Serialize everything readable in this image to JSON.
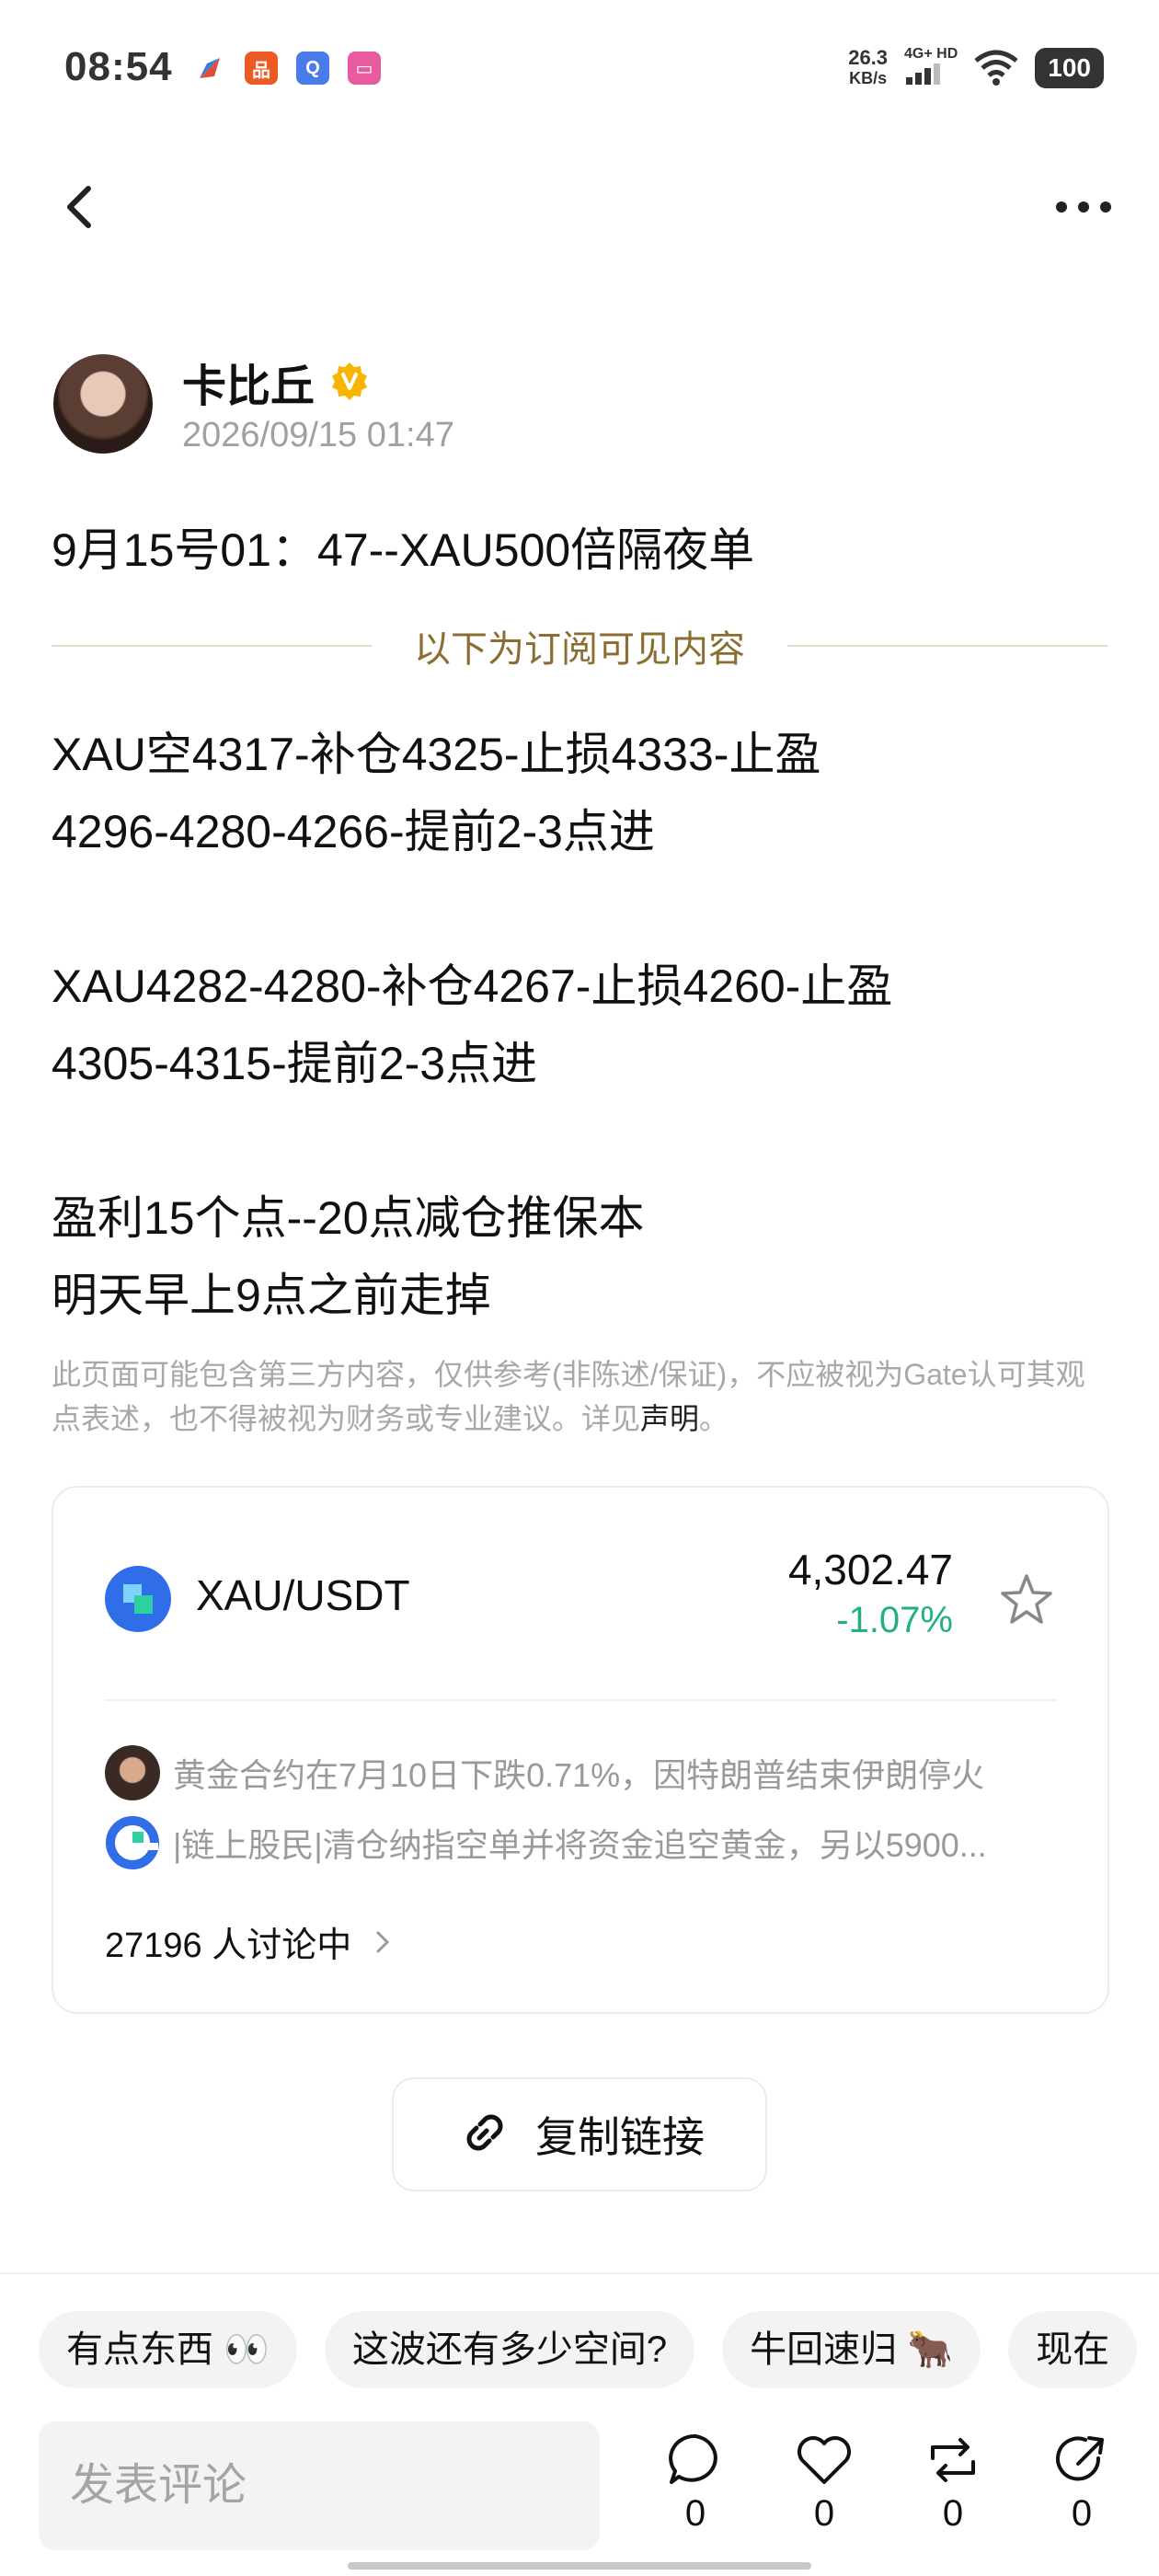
{
  "status_bar": {
    "time": "08:54",
    "speed_value": "26.3",
    "speed_unit": "KB/s",
    "network": "4G+ HD",
    "battery": "100"
  },
  "author": {
    "name": "卡比丘",
    "time": "2026/09/15 01:47"
  },
  "post": {
    "title": "9月15号01：47--XAU500倍隔夜单",
    "subscribe_divider": "以下为订阅可见内容",
    "lines": [
      "XAU空4317-补仓4325-止损4333-止盈",
      "4296-4280-4266-提前2-3点进",
      "",
      "XAU4282-4280-补仓4267-止损4260-止盈",
      "4305-4315-提前2-3点进",
      "",
      "盈利15个点--20点减仓推保本",
      "明天早上9点之前走掉"
    ],
    "disclaimer": "此页面可能包含第三方内容，仅供参考(非陈述/保证)，不应被视为Gate认可其观点表述，也不得被视为财务或专业建议。详见",
    "disclaimer_link": "声明",
    "disclaimer_end": "。"
  },
  "market_card": {
    "pair": "XAU/USDT",
    "price": "4,302.47",
    "change": "-1.07%",
    "change_color": "#22b07d",
    "news": [
      "黄金合约在7月10日下跌0.71%，因特朗普结束伊朗停火",
      "|链上股民|清仓纳指空单并将资金追空黄金，另以5900..."
    ],
    "discussing": "27196 人讨论中"
  },
  "copy_link_label": "复制链接",
  "quick_replies": [
    "有点东西 👀",
    "这波还有多少空间?",
    "牛回速归 🐂",
    "现在"
  ],
  "comment_placeholder": "发表评论",
  "actions": {
    "comments": "0",
    "likes": "0",
    "reposts": "0",
    "shares": "0"
  }
}
